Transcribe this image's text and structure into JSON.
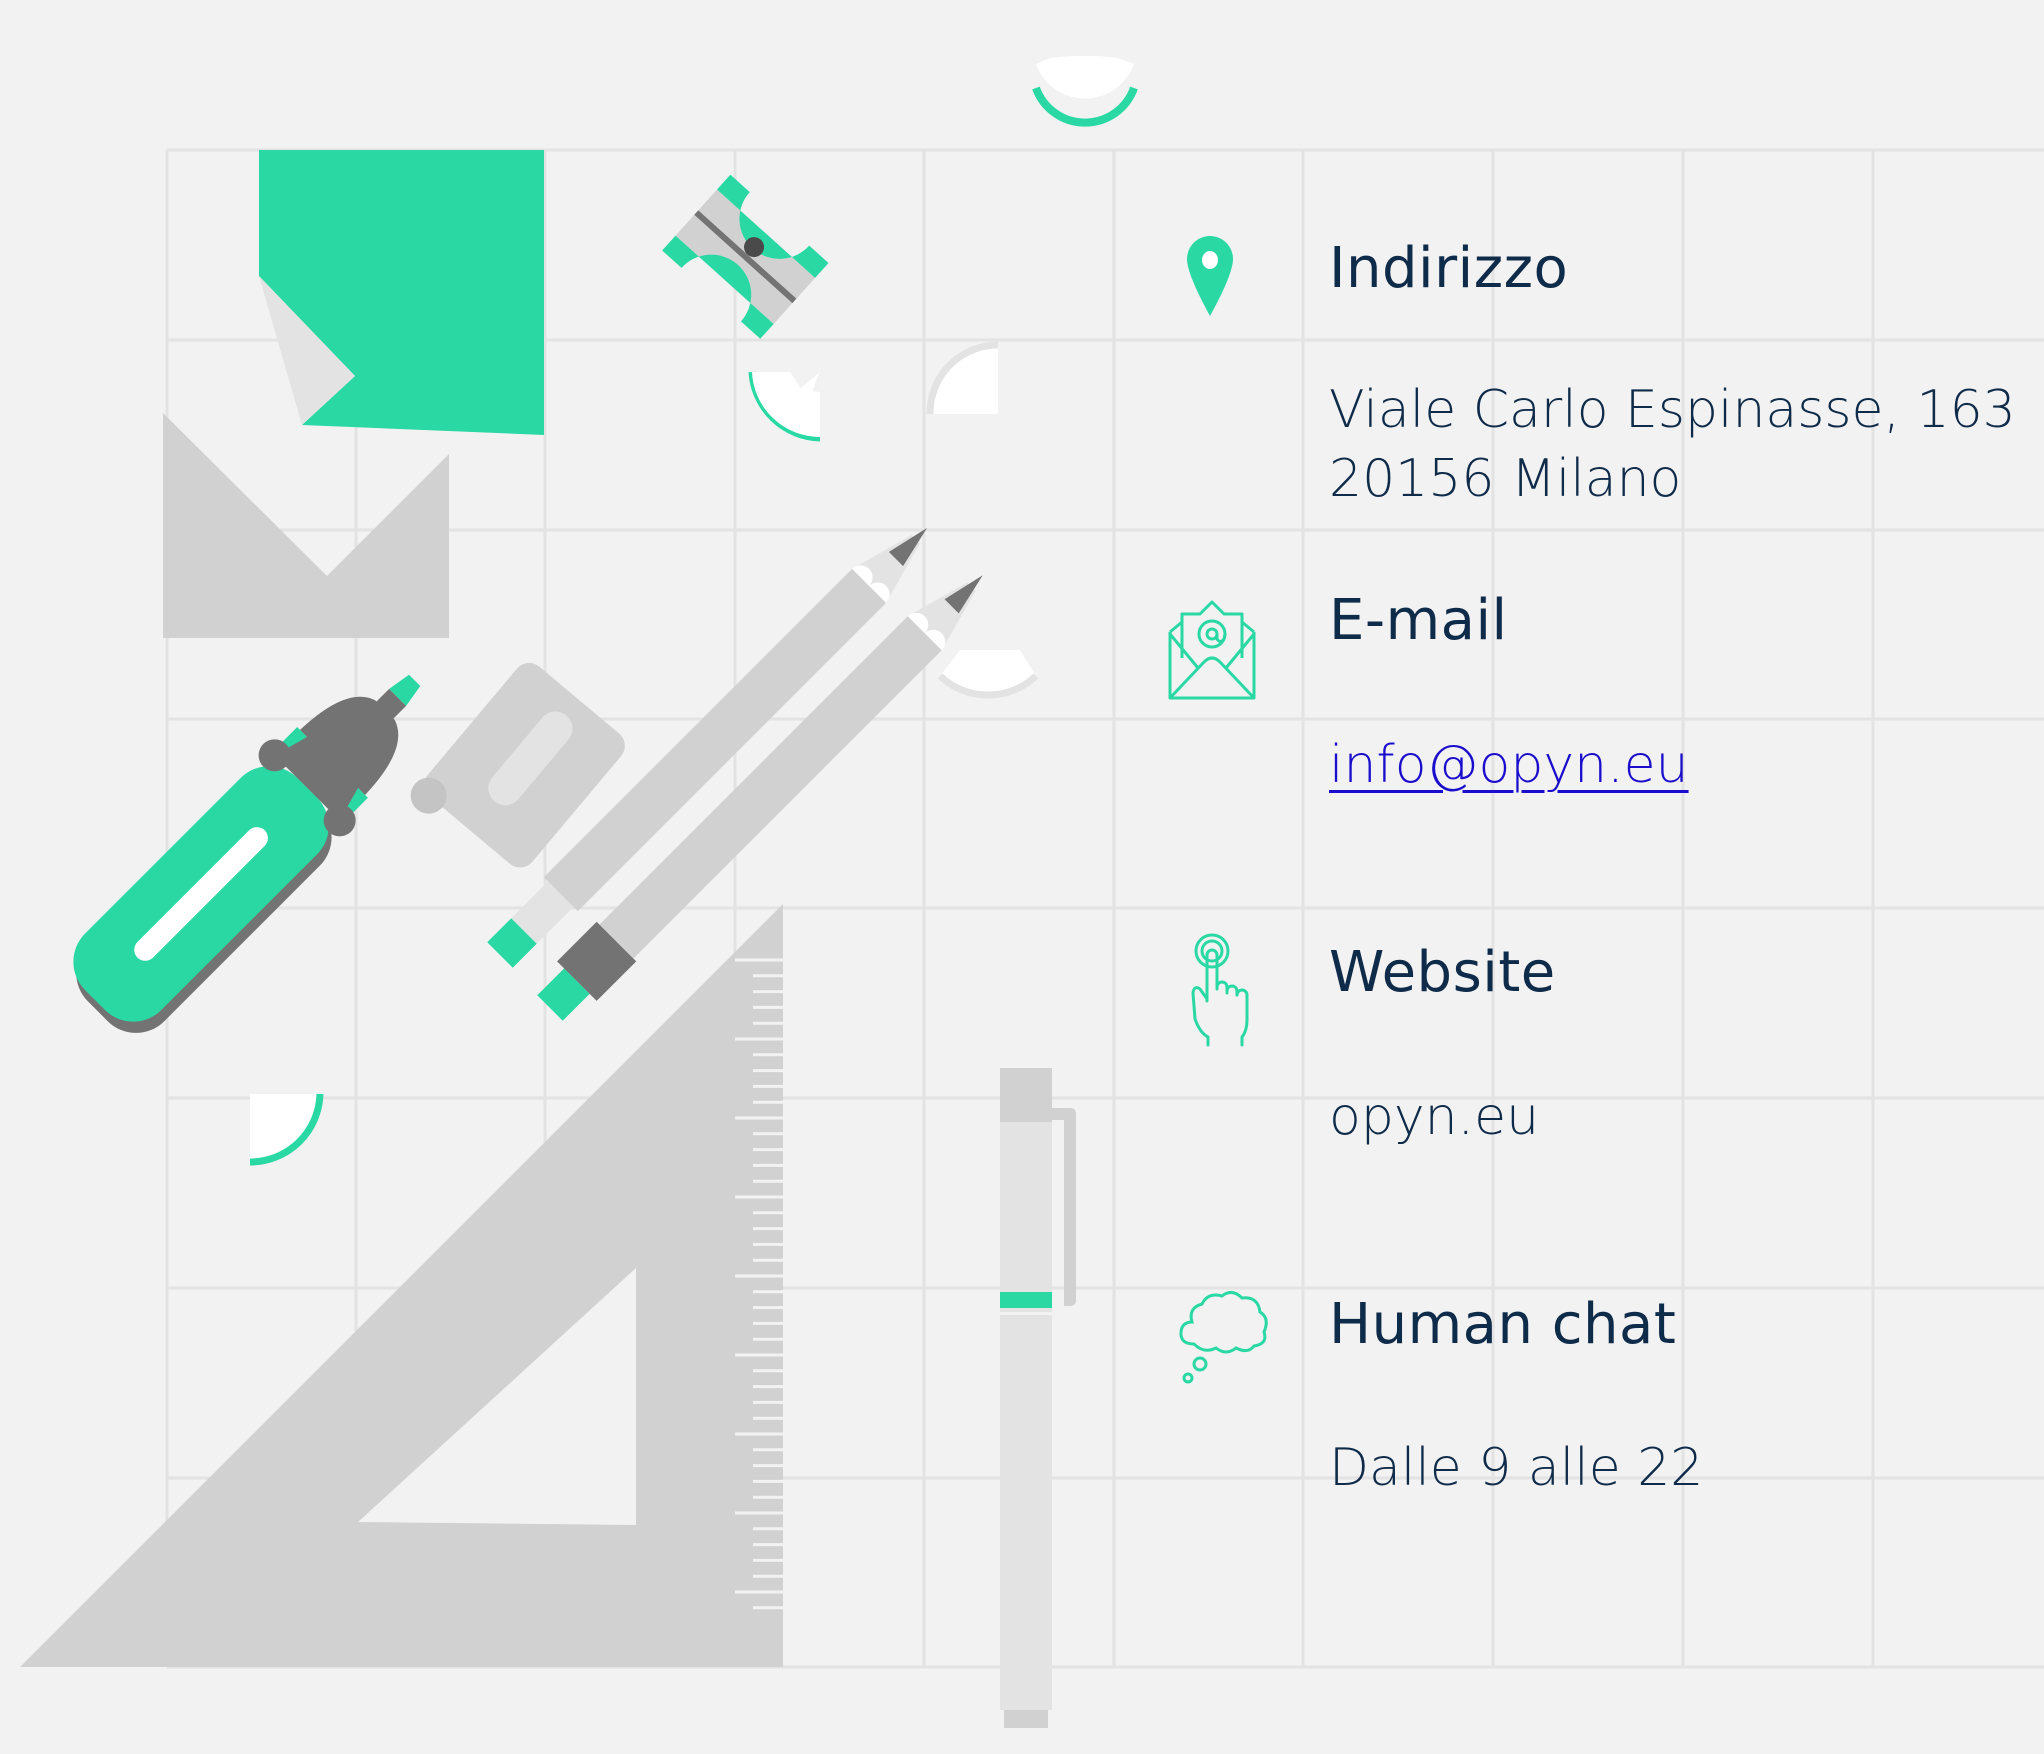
{
  "colors": {
    "background": "#f2f2f2",
    "grid": "#e3e3e3",
    "accent": "#2ad8a3",
    "gray_light": "#d1d1d1",
    "gray_lighter": "#e3e3e3",
    "gray_dark": "#737373",
    "text": "#0f2b4a",
    "link": "#1a0dcc"
  },
  "contact": {
    "address": {
      "icon": "location-pin-icon",
      "title": "Indirizzo",
      "line1": "Viale Carlo Espinasse, 163",
      "line2": "20156 Milano"
    },
    "email": {
      "icon": "email-envelope-icon",
      "title": "E-mail",
      "value": "info@opyn.eu"
    },
    "website": {
      "icon": "touch-hand-icon",
      "title": "Website",
      "value": "opyn.eu"
    },
    "chat": {
      "icon": "thought-cloud-icon",
      "title": "Human chat",
      "value": "Dalle 9 alle 22"
    }
  }
}
